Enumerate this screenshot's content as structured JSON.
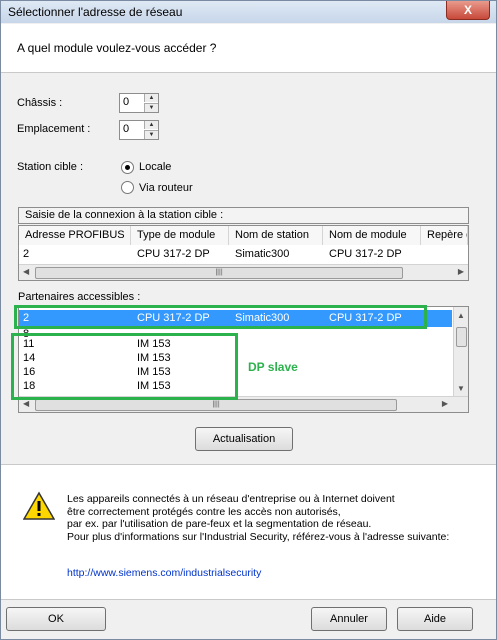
{
  "window": {
    "title": "Sélectionner l'adresse de réseau",
    "close_label": "X"
  },
  "header": {
    "question": "A quel module voulez-vous accéder ?"
  },
  "fields": {
    "chassis": {
      "label": "Châssis :",
      "value": "0"
    },
    "emplacement": {
      "label": "Emplacement :",
      "value": "0"
    },
    "station": {
      "label": "Station cible :",
      "options": [
        "Locale",
        "Via routeur"
      ],
      "selected": "Locale"
    }
  },
  "connection": {
    "group_label": "Saisie de la connexion à la station cible :",
    "columns": [
      "Adresse PROFIBUS",
      "Type de module",
      "Nom de station",
      "Nom de module",
      "Repère d"
    ],
    "row": [
      "2",
      "CPU 317-2 DP",
      "Simatic300",
      "CPU 317-2 DP",
      ""
    ]
  },
  "partners": {
    "label": "Partenaires accessibles :",
    "selected_row": [
      "2",
      "CPU 317-2 DP",
      "Simatic300",
      "CPU 317-2 DP"
    ],
    "partial_row": "8",
    "rows": [
      {
        "addr": "11",
        "type": "IM 153"
      },
      {
        "addr": "14",
        "type": "IM 153"
      },
      {
        "addr": "16",
        "type": "IM 153"
      },
      {
        "addr": "18",
        "type": "IM 153"
      }
    ],
    "annotation": "DP slave"
  },
  "refresh_button": "Actualisation",
  "security": {
    "lines": [
      "Les appareils connectés à un réseau d'entreprise ou à Internet doivent",
      "être correctement protégés contre les accès non autorisés,",
      "par ex. par l'utilisation de pare-feux et la segmentation de réseau.",
      "Pour plus d'informations sur l'Industrial Security, référez-vous à l'adresse suivante:"
    ],
    "link": "http://www.siemens.com/industrialsecurity"
  },
  "buttons": {
    "ok": "OK",
    "cancel": "Annuler",
    "help": "Aide"
  },
  "colors": {
    "selection": "#3399ff",
    "annotation": "#2bb24c",
    "link": "#0033cc",
    "warning": "#ffd700"
  }
}
